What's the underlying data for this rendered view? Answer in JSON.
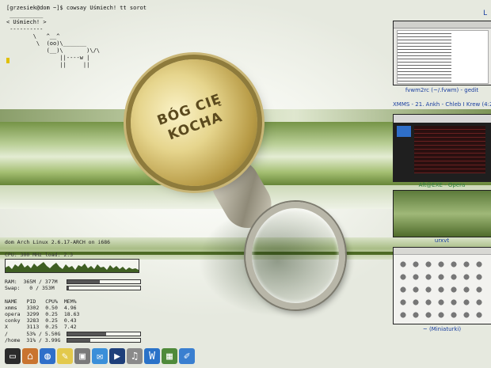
{
  "terminal": {
    "prompt": "[grzesiek@dom ~]$ cowsay Uśmiech! tt sorot",
    "cowsay": " __________\n< Uśmiech! >\n ----------\n        \\   ^__^\n         \\  (oo)\\_______\n            (__)\\       )\\/\\\n                ||----w |\n                ||     ||"
  },
  "conky": {
    "system": "dom Arch Linux 2.6.17-ARCH on i686",
    "cpu": "CPU: 300 MHz       load: 2.3",
    "ram": {
      "label": "RAM:  365M / 377M",
      "fraction": 0.45
    },
    "swap": {
      "label": "Swap:   0 / 353M",
      "fraction": 0.02
    },
    "proc_headers": [
      "NAME",
      "PID",
      "CPU%",
      "MEM%"
    ],
    "processes": [
      [
        "xmms",
        "3302",
        "0.50",
        "4.96"
      ],
      [
        "opera",
        "3299",
        "0.25",
        "18.63"
      ],
      [
        "conky",
        "3283",
        "0.25",
        "0.43"
      ],
      [
        "X",
        "3113",
        "0.25",
        "7.42"
      ]
    ],
    "fs": [
      {
        "label": "/      53% / 5.50G",
        "fraction": 0.53
      },
      {
        "label": "/home  31% / 3.99G",
        "fraction": 0.31
      }
    ]
  },
  "cap_text": "BÓG CIĘ\nKOCHA",
  "pager": {
    "top_icon": "L",
    "windows": [
      {
        "caption": "fvwm2rc (~/.fvwm) - gedit",
        "color": "#1a3fa0"
      },
      {
        "caption": "XMMS - 21. Ankh - Chleb I Krew (4:27)",
        "color": "#1a3fa0"
      },
      {
        "caption": "Aft@EXE - Opera",
        "color": "#2f7f3f"
      },
      {
        "caption": "urxvt",
        "color": "#1a3fa0"
      },
      {
        "caption": "~ (Miniaturki)",
        "color": "#1a3fa0"
      }
    ]
  },
  "dock": [
    "terminal-icon",
    "home-icon",
    "globe-icon",
    "notes-icon",
    "media-icon",
    "chat-icon",
    "video-icon",
    "music-icon",
    "word-icon",
    "image-icon",
    "edit-icon"
  ]
}
